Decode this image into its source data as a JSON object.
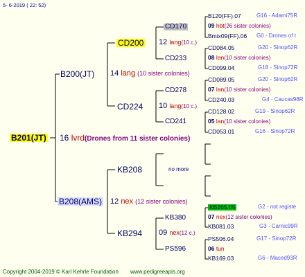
{
  "header": {
    "date": "5-  6-2019 ( 22: 52)"
  },
  "footer": {
    "copyright": "Copyright 2004-2019 © Karl Kehrle Foundation",
    "site": "www.pedigreeapis.org"
  },
  "root": {
    "name": "B201(JT)",
    "num": "16",
    "abbr": "lvrd",
    "desc": "(Drones from 11 sister colonies)"
  },
  "gen1": {
    "top": {
      "name": "B200(JT)",
      "num": "14",
      "abbr": "lang",
      "desc": "(10 sister colonies)"
    },
    "bottom": {
      "name": "B208(AMS)",
      "num": "12",
      "abbr": "nex",
      "desc": "(12 sister colonies)"
    }
  },
  "gen2": {
    "cd200": {
      "name": "CD200",
      "num": "12",
      "abbr": "lang",
      "desc": "(10 c.)"
    },
    "cd224": {
      "name": "CD224",
      "num": "10",
      "abbr": "lang",
      "desc": "(10 c.)"
    },
    "kb208": {
      "name": "KB208",
      "nomore": "no more"
    },
    "kb294": {
      "name": "KB294",
      "num": "09",
      "abbr": "nex",
      "desc": "(12 c.)"
    }
  },
  "gen3": {
    "cd170": {
      "name": "CD170"
    },
    "cd233": {
      "name": "CD233"
    },
    "cd278": {
      "name": "CD278"
    },
    "cd241": {
      "name": "CD241"
    },
    "kb380": {
      "name": "KB380"
    },
    "ps596": {
      "name": "PS596"
    }
  },
  "gen4": [
    {
      "name": "B120(FF).07",
      "group": "G16 - Adami75R"
    },
    {
      "num": "09",
      "abbr": "hbt",
      "desc": "(26 sister colonies)"
    },
    {
      "name": "Bmix09(FF).06",
      "group": "G0 - Drones of t"
    },
    {
      "name": "CD084.05",
      "group": "G20 - Sinop62R"
    },
    {
      "num": "08",
      "abbr": "lan",
      "desc": "(10 sister colonies)"
    },
    {
      "name": "CD099.04",
      "group": "G18 - Sinop72R"
    },
    {
      "name": "CD089.05",
      "group": "G20 - Sinop62R"
    },
    {
      "num": "07",
      "abbr": "lan",
      "desc": "(10 sister colonies)"
    },
    {
      "name": "CD240.03",
      "group": "G4 - Caucas98R"
    },
    {
      "name": "CD128.02",
      "group": "G19 - Sinop62R"
    },
    {
      "num": "05",
      "abbr": "lan",
      "desc": "(10 sister colonies)"
    },
    {
      "name": "CD053.01",
      "group": "G16 - Sinop72R"
    },
    {
      "name": "KB265.05",
      "group": "G2 - not registe"
    },
    {
      "num": "07",
      "abbr": "nex",
      "desc": "(12 sister colonies)"
    },
    {
      "name": "KB081.03",
      "group": "G3 - Carnic99R"
    },
    {
      "name": "PS506.04",
      "group": "G17 - Sinop72R"
    },
    {
      "num": "06",
      "abbr": "tun",
      "desc": ""
    },
    {
      "name": "KB169.03",
      "group": "G6 - Maced93R"
    }
  ]
}
